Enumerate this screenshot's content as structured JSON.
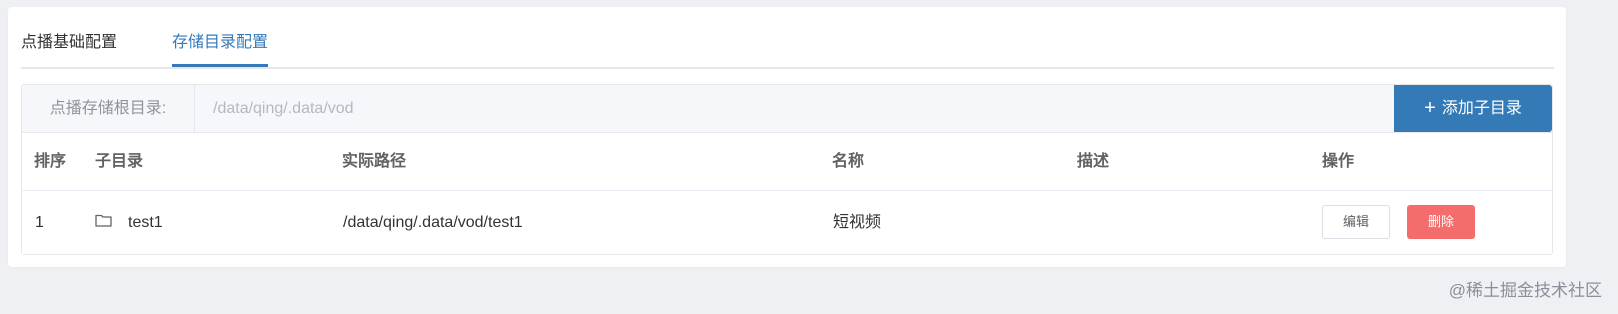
{
  "tabs": [
    {
      "label": "点播基础配置",
      "active": false
    },
    {
      "label": "存储目录配置",
      "active": true
    }
  ],
  "root": {
    "label": "点播存储根目录:",
    "value": "/data/qing/.data/vod",
    "add_button": "添加子目录"
  },
  "table": {
    "headers": [
      "排序",
      "子目录",
      "实际路径",
      "名称",
      "描述",
      "操作"
    ],
    "rows": [
      {
        "order": "1",
        "subdir": "test1",
        "path": "/data/qing/.data/vod/test1",
        "name": "短视频",
        "desc": "",
        "edit": "编辑",
        "delete": "删除"
      }
    ]
  },
  "watermark": "@稀土掘金技术社区",
  "colors": {
    "accent": "#337ab7",
    "danger": "#f56c6c"
  }
}
